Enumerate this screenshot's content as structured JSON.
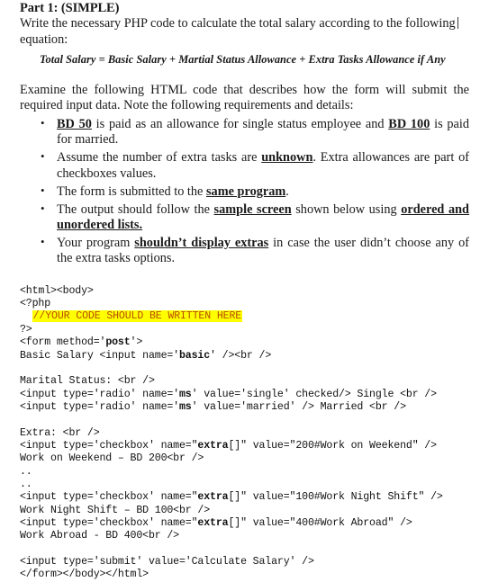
{
  "document": {
    "title": "Part 1: (SIMPLE)",
    "intro": {
      "text": "Write the necessary PHP code to calculate the total salary according to the following",
      "continuation": "equation:"
    },
    "equation": "Total Salary = Basic Salary + Martial Status Allowance + Extra Tasks Allowance if Any",
    "examine_paragraph": "Examine the following HTML code that describes how the form will submit the required input data. Note the following requirements and details:",
    "requirements": [
      {
        "segments": [
          {
            "type": "bold-underline",
            "text": "BD 50"
          },
          {
            "type": "plain",
            "text": " is paid as an allowance for single status employee and "
          },
          {
            "type": "bold-underline",
            "text": "BD 100"
          },
          {
            "type": "plain",
            "text": " is paid for married."
          }
        ]
      },
      {
        "segments": [
          {
            "type": "plain",
            "text": "Assume the number of extra tasks are "
          },
          {
            "type": "bold-underline",
            "text": "unknown"
          },
          {
            "type": "plain",
            "text": ". Extra allowances are part of checkboxes values."
          }
        ]
      },
      {
        "segments": [
          {
            "type": "plain",
            "text": "The form is submitted to the "
          },
          {
            "type": "bold-underline",
            "text": "same program"
          },
          {
            "type": "plain",
            "text": "."
          }
        ]
      },
      {
        "segments": [
          {
            "type": "plain",
            "text": "The output should follow the "
          },
          {
            "type": "bold-underline",
            "text": "sample screen"
          },
          {
            "type": "plain",
            "text": " shown below using "
          },
          {
            "type": "bold-underline",
            "text": "ordered and unordered lists."
          }
        ]
      },
      {
        "segments": [
          {
            "type": "plain",
            "text": "Your program "
          },
          {
            "type": "bold-underline",
            "text": "shouldn’t display extras"
          },
          {
            "type": "plain",
            "text": " in case the user didn’t choose any of the extra tasks options."
          }
        ]
      }
    ],
    "code_listing": {
      "language": "html-php",
      "highlight_background": "#ffff00",
      "highlight_text_color": "#b84a06",
      "lines": [
        {
          "id": "l01",
          "parts": [
            {
              "t": "plain",
              "v": "<html><body>"
            }
          ]
        },
        {
          "id": "l02",
          "parts": [
            {
              "t": "plain",
              "v": "<?php"
            }
          ]
        },
        {
          "id": "l03",
          "parts": [
            {
              "t": "plain",
              "v": "  "
            },
            {
              "t": "highlight",
              "v": "//YOUR CODE SHOULD BE WRITTEN HERE"
            }
          ]
        },
        {
          "id": "l04",
          "parts": [
            {
              "t": "plain",
              "v": "?>"
            }
          ]
        },
        {
          "id": "l05",
          "parts": [
            {
              "t": "plain",
              "v": "<form method='"
            },
            {
              "t": "bold",
              "v": "post"
            },
            {
              "t": "plain",
              "v": "'>"
            }
          ]
        },
        {
          "id": "l06",
          "parts": [
            {
              "t": "plain",
              "v": "Basic Salary <input name='"
            },
            {
              "t": "bold",
              "v": "basic"
            },
            {
              "t": "plain",
              "v": "' /><br />"
            }
          ]
        },
        {
          "id": "l07",
          "parts": [
            {
              "t": "blank",
              "v": ""
            }
          ]
        },
        {
          "id": "l08",
          "parts": [
            {
              "t": "plain",
              "v": "Marital Status: <br />"
            }
          ]
        },
        {
          "id": "l09",
          "parts": [
            {
              "t": "plain",
              "v": "<input type='radio' name='"
            },
            {
              "t": "bold",
              "v": "ms"
            },
            {
              "t": "plain",
              "v": "' value='single' checked/> Single <br />"
            }
          ]
        },
        {
          "id": "l10",
          "parts": [
            {
              "t": "plain",
              "v": "<input type='radio' name='"
            },
            {
              "t": "bold",
              "v": "ms"
            },
            {
              "t": "plain",
              "v": "' value='married' /> Married <br />"
            }
          ]
        },
        {
          "id": "l11",
          "parts": [
            {
              "t": "blank",
              "v": ""
            }
          ]
        },
        {
          "id": "l12",
          "parts": [
            {
              "t": "plain",
              "v": "Extra: <br />"
            }
          ]
        },
        {
          "id": "l13",
          "parts": [
            {
              "t": "plain",
              "v": "<input type='checkbox' name=\""
            },
            {
              "t": "bold",
              "v": "extra"
            },
            {
              "t": "plain",
              "v": "[]\" value=\"200#Work on Weekend\" />"
            }
          ]
        },
        {
          "id": "l14",
          "parts": [
            {
              "t": "plain",
              "v": "Work on Weekend – BD 200<br />"
            }
          ]
        },
        {
          "id": "l15",
          "parts": [
            {
              "t": "plain",
              "v": ".."
            }
          ]
        },
        {
          "id": "l16",
          "parts": [
            {
              "t": "plain",
              "v": ".."
            }
          ]
        },
        {
          "id": "l17",
          "parts": [
            {
              "t": "plain",
              "v": "<input type='checkbox' name=\""
            },
            {
              "t": "bold",
              "v": "extra"
            },
            {
              "t": "plain",
              "v": "[]\" value=\"100#Work Night Shift\" />"
            }
          ]
        },
        {
          "id": "l18",
          "parts": [
            {
              "t": "plain",
              "v": "Work Night Shift – BD 100<br />"
            }
          ]
        },
        {
          "id": "l19",
          "parts": [
            {
              "t": "plain",
              "v": "<input type='checkbox' name=\""
            },
            {
              "t": "bold",
              "v": "extra"
            },
            {
              "t": "plain",
              "v": "[]\" value=\"400#Work Abroad\" />"
            }
          ]
        },
        {
          "id": "l20",
          "parts": [
            {
              "t": "plain",
              "v": "Work Abroad - BD 400<br />"
            }
          ]
        },
        {
          "id": "l21",
          "parts": [
            {
              "t": "blank",
              "v": ""
            }
          ]
        },
        {
          "id": "l22",
          "parts": [
            {
              "t": "plain",
              "v": "<input type='submit' value='Calculate Salary' />"
            }
          ]
        },
        {
          "id": "l23",
          "parts": [
            {
              "t": "plain",
              "v": "</form></body></html>"
            }
          ]
        }
      ]
    }
  }
}
